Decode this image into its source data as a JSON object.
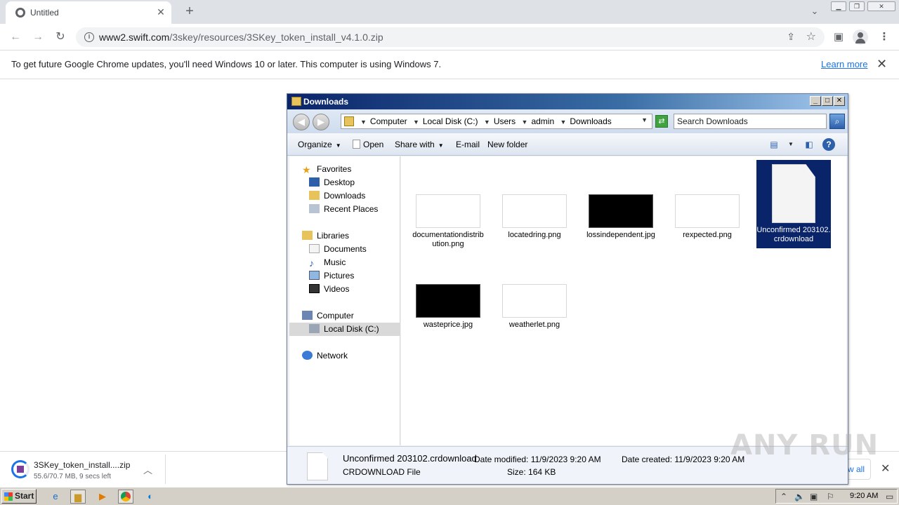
{
  "browser": {
    "tab_title": "Untitled",
    "url_host": "www2.swift.com",
    "url_path": "/3skey/resources/3SKey_token_install_v4.1.0.zip",
    "infobar_message": "To get future Google Chrome updates, you'll need Windows 10 or later. This computer is using Windows 7.",
    "infobar_link": "Learn more"
  },
  "download": {
    "filename": "3SKey_token_install....zip",
    "status": "55.6/70.7 MB, 9 secs left",
    "progress_fraction": 0.786,
    "show_all": "w all"
  },
  "explorer": {
    "title": "Downloads",
    "breadcrumbs": [
      "Computer",
      "Local Disk (C:)",
      "Users",
      "admin",
      "Downloads"
    ],
    "search_placeholder": "Search Downloads",
    "commands": {
      "organize": "Organize",
      "open": "Open",
      "share_with": "Share with",
      "email": "E-mail",
      "new_folder": "New folder"
    },
    "nav": {
      "favorites": "Favorites",
      "desktop": "Desktop",
      "downloads": "Downloads",
      "recent_places": "Recent Places",
      "libraries": "Libraries",
      "documents": "Documents",
      "music": "Music",
      "pictures": "Pictures",
      "videos": "Videos",
      "computer": "Computer",
      "local_disk": "Local Disk (C:)",
      "network": "Network"
    },
    "files": [
      {
        "name": "documentationdistribution.png",
        "thumb": "light"
      },
      {
        "name": "locatedring.png",
        "thumb": "light"
      },
      {
        "name": "lossindependent.jpg",
        "thumb": "dark"
      },
      {
        "name": "rexpected.png",
        "thumb": "light"
      },
      {
        "name": "Unconfirmed 203102.crdownload",
        "thumb": "doc"
      },
      {
        "name": "wasteprice.jpg",
        "thumb": "dark"
      },
      {
        "name": "weatherlet.png",
        "thumb": "light"
      }
    ],
    "details": {
      "name": "Unconfirmed 203102.crdownload",
      "type": "CRDOWNLOAD File",
      "modified_label": "Date modified:",
      "modified_value": "11/9/2023 9:20 AM",
      "size_label": "Size:",
      "size_value": "164 KB",
      "created_label": "Date created:",
      "created_value": "11/9/2023 9:20 AM"
    }
  },
  "taskbar": {
    "start_label": "Start",
    "clock": "9:20 AM"
  },
  "watermark": "ANY RUN"
}
